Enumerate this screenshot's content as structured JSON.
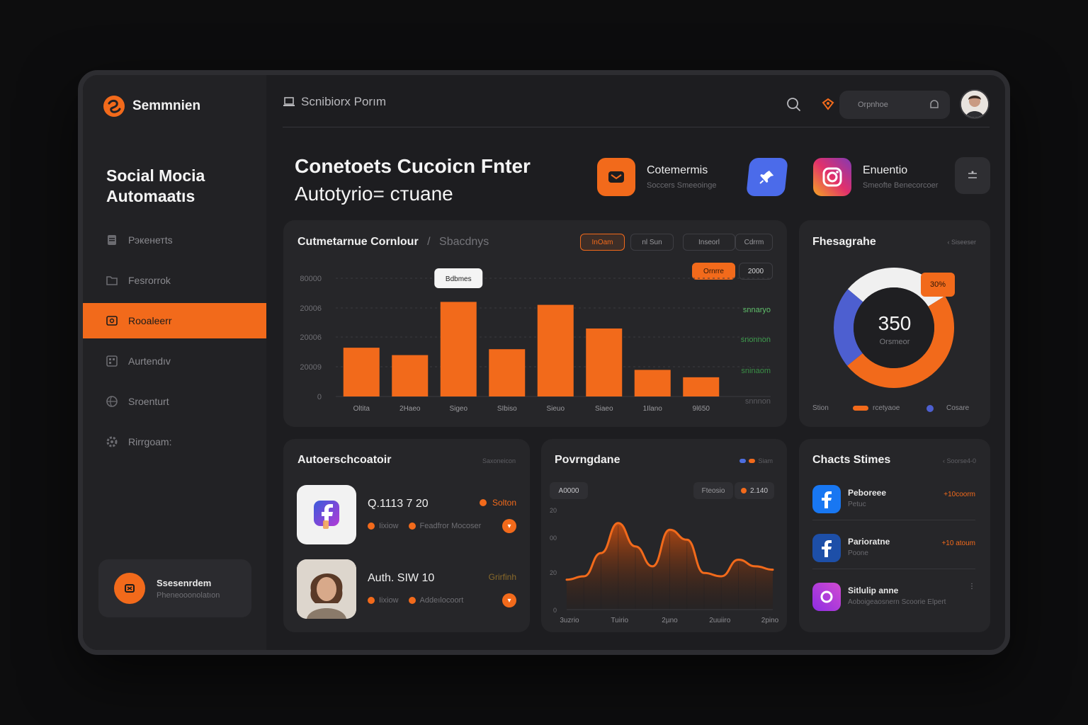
{
  "brand": {
    "name": "Semmnien"
  },
  "sidebar": {
    "title_line1": "Social Mocia",
    "title_line2": "Automaatıs",
    "items": [
      {
        "label": "Рэкенетts",
        "icon": "document-icon"
      },
      {
        "label": "Fesrorrok",
        "icon": "folder-icon"
      },
      {
        "label": "Rooaleerr",
        "icon": "image-icon",
        "active": true
      },
      {
        "label": "Aurtendıv",
        "icon": "grid-icon"
      },
      {
        "label": "Sroenturt",
        "icon": "globe-icon"
      },
      {
        "label": "Rirrgoam:",
        "icon": "gear-icon"
      }
    ],
    "promo": {
      "title": "Ssesenrdem",
      "subtitle": "Pheneooonolatıon"
    }
  },
  "topbar": {
    "title": "Scnibiorx Porım",
    "pill_text": "Orpnhoe"
  },
  "hero": {
    "line1": "Conetoets Cucoicn Fnter",
    "line2": "Autotyrio= cтuane",
    "apps": [
      {
        "title": "Cotemermis",
        "subtitle": "Soccers Smeeoinge",
        "icon": "mail-icon"
      },
      {
        "title": "",
        "subtitle": "",
        "icon": "pin-icon"
      },
      {
        "title": "Enuentio",
        "subtitle": "Smeofte Benecorcoer",
        "icon": "instagram-icon"
      }
    ]
  },
  "bar_card": {
    "title": "Cutmetarnue Cornlour",
    "separator": "/",
    "subtitle": "Sbacdnys",
    "chips": [
      "InOam",
      "nl Sun",
      "Inseorl",
      "Cdrrm"
    ],
    "chip_fill": "Ornrre",
    "chip_year": "2000",
    "tooltip": "Bdbmes",
    "right_labels": [
      "snnaryo",
      "snonnon",
      "sninaom",
      "snnnon"
    ]
  },
  "donut_card": {
    "title": "Fhesagrahe",
    "corner": "‹ Siseeser",
    "center_value": "350",
    "center_label": "Orsmeor",
    "badge": "30%",
    "legend": [
      "Stion",
      "rcetyaoe",
      "Cosare"
    ]
  },
  "auto_card": {
    "title": "Autoerschcoatoir",
    "corner": "Saxoneicon",
    "rows": [
      {
        "name": "Q.1113 7 20",
        "status": "Solton",
        "meta1": "Iixiow",
        "meta2": "Feadfror Mocoser",
        "thumb": "facebook-logo"
      },
      {
        "name": "Auth. SIW 10",
        "status": "Grirfinh",
        "meta1": "Iixiow",
        "meta2": "Addeılocoort",
        "thumb": "person-photo"
      }
    ]
  },
  "perf_card": {
    "title": "Povrngdane",
    "corner": "Siam",
    "chip_left": "A0000",
    "chip_right1": "Fteosio",
    "chip_right2": "2.140",
    "y_ticks": [
      "20",
      "00",
      "20",
      "0"
    ],
    "x_ticks": [
      "3uzrio",
      "Tuirio",
      "2µno",
      "2uuiiro",
      "2pino"
    ]
  },
  "chats_card": {
    "title": "Chacts Stimes",
    "corner": "‹ Soorse4-0",
    "rows": [
      {
        "name": "Peboreee",
        "sub": "Petuc",
        "value": "+10coorm",
        "icon": "facebook-icon"
      },
      {
        "name": "Parioratne",
        "sub": "Poone",
        "value": "+10 atoum",
        "icon": "facebook-icon"
      },
      {
        "name": "Sitlulip anne",
        "sub": "Aoboigeaosnern Scoorie Elpert",
        "value": "",
        "icon": "messenger-icon"
      }
    ]
  },
  "chart_data": [
    {
      "type": "bar",
      "categories": [
        "Oltita",
        "2Haeo",
        "Sigeo",
        "SIbiso",
        "Sieuo",
        "Siaeo",
        "1Ilano",
        "9l650"
      ],
      "values": [
        16500,
        14000,
        32000,
        16000,
        31000,
        23000,
        9000,
        6500
      ],
      "y_ticks": [
        "80000",
        "20006",
        "20006",
        "20009",
        "0"
      ],
      "ylim": [
        0,
        40000
      ],
      "grid": true,
      "color": "#f26a1b"
    },
    {
      "type": "pie",
      "values": [
        30,
        48,
        22
      ],
      "colors": [
        "#f0f0f0",
        "#f26a1b",
        "#4d5fd0"
      ]
    },
    {
      "type": "area",
      "x": [
        0,
        1,
        2,
        3,
        4,
        5,
        6,
        7,
        8,
        9,
        10,
        11,
        12
      ],
      "values": [
        18,
        20,
        34,
        52,
        38,
        26,
        48,
        42,
        22,
        20,
        30,
        26,
        24
      ],
      "ylim": [
        0,
        60
      ],
      "color": "#f26a1b"
    }
  ]
}
